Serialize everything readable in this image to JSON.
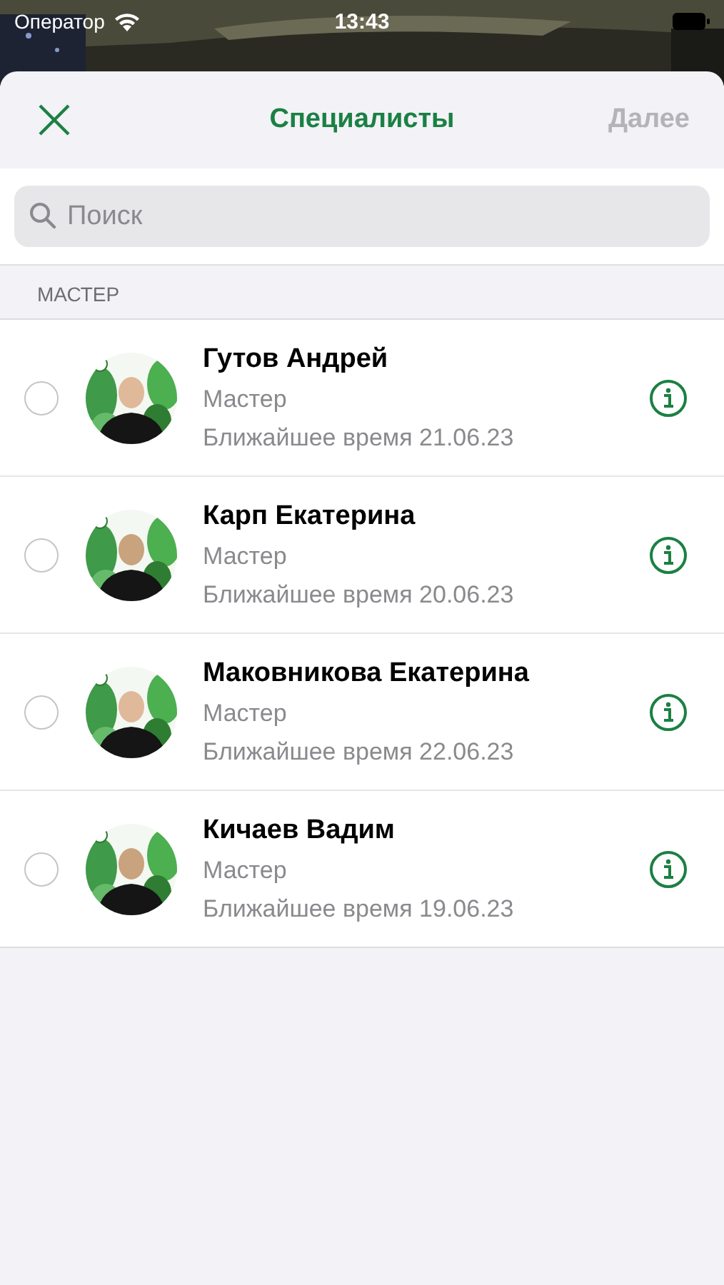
{
  "status_bar": {
    "carrier": "Оператор",
    "time": "13:43"
  },
  "nav": {
    "title": "Специалисты",
    "next": {
      "label": "Далее",
      "disabled": true
    }
  },
  "search": {
    "placeholder": "Поиск"
  },
  "section": {
    "title": "МАСТЕР"
  },
  "specialists": [
    {
      "name": "Гутов Андрей",
      "role": "Мастер",
      "nearest": "Ближайшее время 21.06.23",
      "selected": false
    },
    {
      "name": "Карп Екатерина",
      "role": "Мастер",
      "nearest": "Ближайшее время 20.06.23",
      "selected": false
    },
    {
      "name": "Маковникова Екатерина",
      "role": "Мастер",
      "nearest": "Ближайшее время 22.06.23",
      "selected": false
    },
    {
      "name": "Кичаев Вадим",
      "role": "Мастер",
      "nearest": "Ближайшее время 19.06.23",
      "selected": false
    }
  ]
}
